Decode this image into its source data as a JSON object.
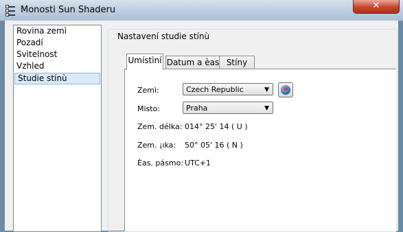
{
  "window": {
    "title": "Monosti Sun Shaderu",
    "close_glyph": "✕"
  },
  "sidebar": {
    "items": [
      {
        "label": "Rovina zemì"
      },
      {
        "label": "Pozadí"
      },
      {
        "label": "Svìtelnost"
      },
      {
        "label": "Vzhled"
      },
      {
        "label": "Studie stínù",
        "selected": true
      }
    ]
  },
  "group": {
    "label": "Nastavení studie stínù"
  },
  "tabs": [
    {
      "label": "Umístìní",
      "active": true
    },
    {
      "label": "Datum a èas"
    },
    {
      "label": "Stíny"
    }
  ],
  "location": {
    "country_label": "Zemì:",
    "country_value": "Czech Republic",
    "place_label": "Misto:",
    "place_value": "Praha",
    "longitude_label": "Zem. délka:",
    "longitude_value": "014° 25' 14 ( U )",
    "latitude_label": "Zem. ¡ıka:",
    "latitude_value": "50° 05' 16 ( N )",
    "timezone_label": "Èas. pásmo:",
    "timezone_value": "UTC+1"
  },
  "icons": {
    "dropdown": "▼",
    "globe": "globe-icon",
    "system_menu": "window-menu-icon"
  }
}
